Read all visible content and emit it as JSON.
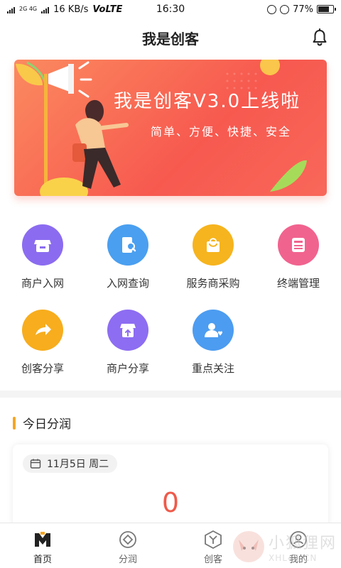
{
  "status_bar": {
    "network_tag": "2G 4G",
    "speed": "16 KB/s",
    "volte": "VoLTE",
    "time": "16:30",
    "battery": "77%",
    "battery_level": 0.77
  },
  "header": {
    "title": "我是创客",
    "bell_icon": "bell-icon"
  },
  "banner": {
    "headline": "我是创客V3.0上线啦",
    "subline": "简单、方便、快捷、安全",
    "colors": {
      "start": "#fb8a5f",
      "end": "#f7594f"
    }
  },
  "shortcuts": [
    {
      "label": "商户入网",
      "icon": "store-icon",
      "color": "#8b6cf0"
    },
    {
      "label": "入网查询",
      "icon": "search-phone-icon",
      "color": "#4a9ff0"
    },
    {
      "label": "服务商采购",
      "icon": "shopping-bag-icon",
      "color": "#f6b41e"
    },
    {
      "label": "终端管理",
      "icon": "terminal-icon",
      "color": "#f1638f"
    },
    {
      "label": "创客分享",
      "icon": "share-arrow-icon",
      "color": "#f7ad1d"
    },
    {
      "label": "商户分享",
      "icon": "store-upload-icon",
      "color": "#8d6df2"
    },
    {
      "label": "重点关注",
      "icon": "user-heart-icon",
      "color": "#4c9cf1"
    }
  ],
  "today_profit": {
    "title": "今日分润",
    "date": "11月5日 周二",
    "amount": "0"
  },
  "tabbar": [
    {
      "label": "首页",
      "icon": "home-m-icon",
      "active": true
    },
    {
      "label": "分润",
      "icon": "diamond-icon",
      "active": false
    },
    {
      "label": "创客",
      "icon": "hexagon-y-icon",
      "active": false
    },
    {
      "label": "我的",
      "icon": "profile-icon",
      "active": false
    }
  ],
  "watermark": {
    "text": "小狐狸网",
    "domain": "XHL45.CN"
  }
}
